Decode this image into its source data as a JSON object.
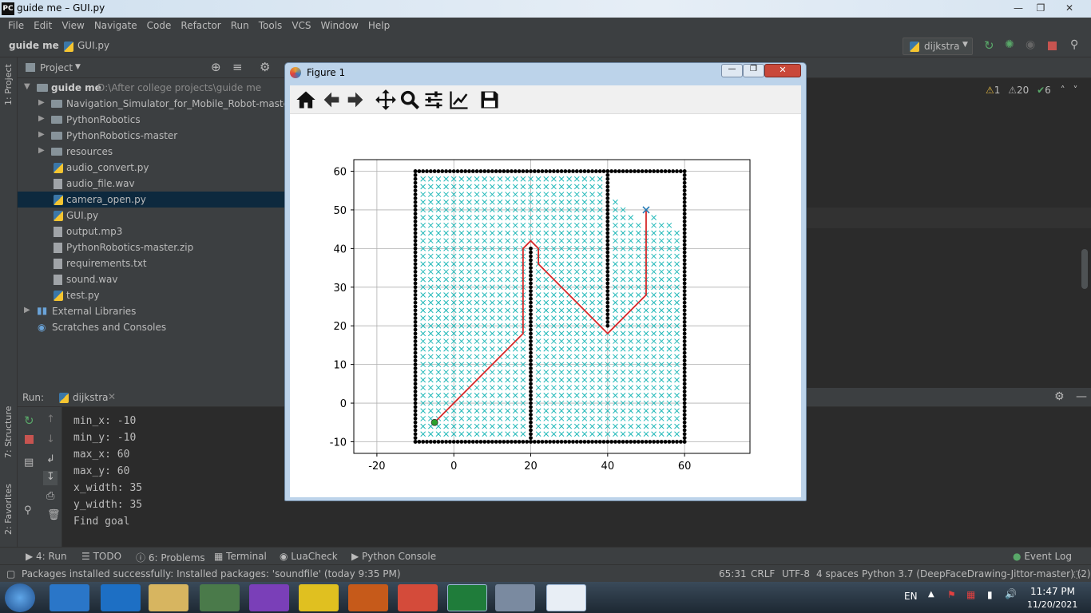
{
  "window": {
    "title": "guide me – GUI.py",
    "app_icon": "PC"
  },
  "menu": [
    "File",
    "Edit",
    "View",
    "Navigate",
    "Code",
    "Refactor",
    "Run",
    "Tools",
    "VCS",
    "Window",
    "Help"
  ],
  "breadcrumb": {
    "project": "guide me",
    "file": "GUI.py"
  },
  "run_config": "dijkstra",
  "project_panel": {
    "title": "Project",
    "root": "guide me",
    "root_path": "D:\\After college projects\\guide me",
    "items": [
      {
        "label": "Navigation_Simulator_for_Mobile_Robot-master",
        "kind": "folder"
      },
      {
        "label": "PythonRobotics",
        "kind": "folder"
      },
      {
        "label": "PythonRobotics-master",
        "kind": "folder"
      },
      {
        "label": "resources",
        "kind": "folder"
      },
      {
        "label": "audio_convert.py",
        "kind": "py"
      },
      {
        "label": "audio_file.wav",
        "kind": "file"
      },
      {
        "label": "camera_open.py",
        "kind": "py",
        "selected": true
      },
      {
        "label": "GUI.py",
        "kind": "py"
      },
      {
        "label": "output.mp3",
        "kind": "file"
      },
      {
        "label": "PythonRobotics-master.zip",
        "kind": "file"
      },
      {
        "label": "requirements.txt",
        "kind": "file"
      },
      {
        "label": "sound.wav",
        "kind": "file"
      },
      {
        "label": "test.py",
        "kind": "py"
      }
    ],
    "external": "External Libraries",
    "scratches": "Scratches and Consoles"
  },
  "side_tabs": {
    "project": "1: Project",
    "structure": "7: Structure",
    "favorites": "2: Favorites"
  },
  "inspections": {
    "errors": "1",
    "warnings": "20",
    "ok": "6"
  },
  "run_panel": {
    "label": "Run:",
    "tab": "dijkstra",
    "lines": [
      "min_x: -10",
      "min_y: -10",
      "max_x: 60",
      "max_y: 60",
      "x_width: 35",
      "y_width: 35",
      "Find goal"
    ]
  },
  "bottom_tabs": [
    "4: Run",
    "TODO",
    "6: Problems",
    "Terminal",
    "LuaCheck",
    "Python Console"
  ],
  "event_log": "Event Log",
  "status": {
    "message": "Packages installed successfully: Installed packages: 'soundfile' (today 9:35 PM)",
    "position": "65:31",
    "line_sep": "CRLF",
    "encoding": "UTF-8",
    "indent": "4 spaces",
    "interpreter": "Python 3.7 (DeepFaceDrawing-Jittor-master) (2)"
  },
  "taskbar": {
    "lang": "EN",
    "time": "11:47 PM",
    "date": "11/20/2021"
  },
  "figure": {
    "title": "Figure 1"
  },
  "chart_data": {
    "type": "scatter",
    "xlim": [
      -26,
      77
    ],
    "ylim": [
      -13,
      63
    ],
    "xticks": [
      -20,
      0,
      20,
      40,
      60
    ],
    "yticks": [
      -10,
      0,
      10,
      20,
      30,
      40,
      50,
      60
    ],
    "grid": true,
    "obstacle_color": "#000000",
    "explored_color": "#20b8b8",
    "path_color": "#d62728",
    "start": [
      -5,
      -5
    ],
    "goal": [
      50,
      50
    ],
    "path": [
      [
        -5,
        -5
      ],
      [
        18,
        18
      ],
      [
        18,
        40
      ],
      [
        20,
        42
      ],
      [
        22,
        40
      ],
      [
        22,
        36
      ],
      [
        40,
        18
      ],
      [
        50,
        28
      ],
      [
        50,
        50
      ]
    ],
    "walls": [
      [
        [
          -10,
          -10
        ],
        [
          60,
          -10
        ]
      ],
      [
        [
          60,
          -10
        ],
        [
          60,
          60
        ]
      ],
      [
        [
          60,
          60
        ],
        [
          -10,
          60
        ]
      ],
      [
        [
          -10,
          60
        ],
        [
          -10,
          -10
        ]
      ],
      [
        [
          20,
          -10
        ],
        [
          20,
          40
        ]
      ],
      [
        [
          40,
          20
        ],
        [
          40,
          60
        ]
      ]
    ]
  }
}
